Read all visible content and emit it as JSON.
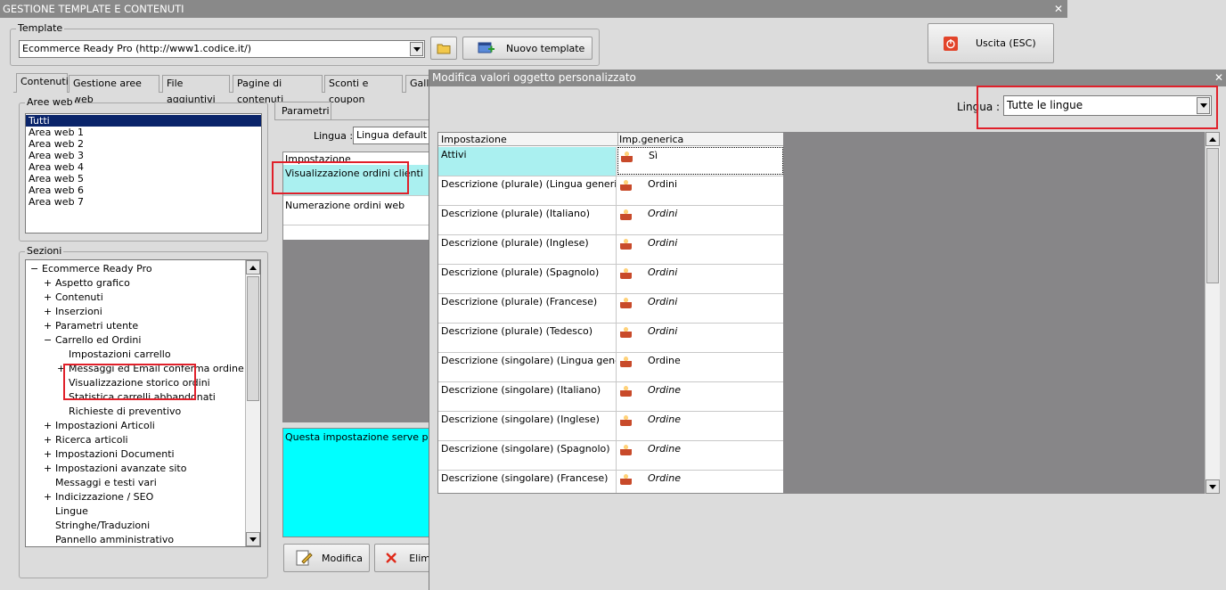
{
  "window": {
    "title": "GESTIONE TEMPLATE E CONTENUTI",
    "close_glyph": "✕"
  },
  "template": {
    "group_label": "Template",
    "selected": "Ecommerce Ready Pro (http://www1.codice.it/)",
    "new_template_label": "Nuovo template"
  },
  "exit_button": {
    "label": "Uscita (ESC)"
  },
  "tabs": [
    {
      "label": "Contenuti",
      "active": true
    },
    {
      "label": "Gestione aree web"
    },
    {
      "label": "File aggiuntivi"
    },
    {
      "label": "Pagine di contenuti"
    },
    {
      "label": "Sconti e coupon"
    },
    {
      "label": "Galle"
    }
  ],
  "aree_web": {
    "label": "Aree web",
    "items": [
      "Tutti",
      "Area web 1",
      "Area web 2",
      "Area web 3",
      "Area web 4",
      "Area web 5",
      "Area web 6",
      "Area web 7"
    ],
    "selected_index": 0
  },
  "sezioni": {
    "label": "Sezioni",
    "tree": [
      {
        "label": "Ecommerce Ready Pro",
        "level": 0,
        "expander": "−"
      },
      {
        "label": "Aspetto grafico",
        "level": 1,
        "expander": "+"
      },
      {
        "label": "Contenuti",
        "level": 1,
        "expander": "+"
      },
      {
        "label": "Inserzioni",
        "level": 1,
        "expander": "+"
      },
      {
        "label": "Parametri utente",
        "level": 1,
        "expander": "+"
      },
      {
        "label": "Carrello ed Ordini",
        "level": 1,
        "expander": "−"
      },
      {
        "label": "Impostazioni carrello",
        "level": 2,
        "expander": ""
      },
      {
        "label": "Messaggi ed Email conferma ordine",
        "level": 2,
        "expander": "+"
      },
      {
        "label": "Visualizzazione storico ordini",
        "level": 2,
        "expander": ""
      },
      {
        "label": "Statistica carrelli abbandonati",
        "level": 2,
        "expander": ""
      },
      {
        "label": "Richieste di preventivo",
        "level": 2,
        "expander": ""
      },
      {
        "label": "Impostazioni Articoli",
        "level": 1,
        "expander": "+"
      },
      {
        "label": "Ricerca articoli",
        "level": 1,
        "expander": "+"
      },
      {
        "label": "Impostazioni Documenti",
        "level": 1,
        "expander": "+"
      },
      {
        "label": "Impostazioni avanzate sito",
        "level": 1,
        "expander": "+"
      },
      {
        "label": "Messaggi e testi vari",
        "level": 1,
        "expander": ""
      },
      {
        "label": "Indicizzazione / SEO",
        "level": 1,
        "expander": "+"
      },
      {
        "label": "Lingue",
        "level": 1,
        "expander": ""
      },
      {
        "label": "Stringhe/Traduzioni",
        "level": 1,
        "expander": ""
      },
      {
        "label": "Pannello amministrativo",
        "level": 1,
        "expander": ""
      }
    ]
  },
  "parametri": {
    "tab_label": "Parametri",
    "lingua_label": "Lingua :",
    "lingua_value": "Lingua default",
    "column_header": "Impostazione",
    "rows": [
      "Visualizzazione ordini clienti",
      "Numerazione ordini web"
    ],
    "description": "Questa impostazione serve per ab",
    "modifica_label": "Modifica",
    "elimina_label": "Elim"
  },
  "dialog": {
    "title": "Modifica valori oggetto personalizzato",
    "lingua_label": "Lingua :",
    "lingua_value": "Tutte le lingue",
    "headers": {
      "name": "Impostazione",
      "value": "Imp.generica"
    },
    "rows": [
      {
        "name": "Attivi",
        "value": "Sì",
        "italic": false
      },
      {
        "name": "Descrizione (plurale) (Lingua generica)",
        "value": "Ordini",
        "italic": false
      },
      {
        "name": "Descrizione (plurale) (Italiano)",
        "value": "Ordini",
        "italic": true
      },
      {
        "name": "Descrizione (plurale) (Inglese)",
        "value": "Ordini",
        "italic": true
      },
      {
        "name": "Descrizione (plurale) (Spagnolo)",
        "value": "Ordini",
        "italic": true
      },
      {
        "name": "Descrizione (plurale) (Francese)",
        "value": "Ordini",
        "italic": true
      },
      {
        "name": "Descrizione (plurale) (Tedesco)",
        "value": "Ordini",
        "italic": true
      },
      {
        "name": "Descrizione (singolare) (Lingua generica)",
        "value": "Ordine",
        "italic": false
      },
      {
        "name": "Descrizione (singolare) (Italiano)",
        "value": "Ordine",
        "italic": true
      },
      {
        "name": "Descrizione (singolare) (Inglese)",
        "value": "Ordine",
        "italic": true
      },
      {
        "name": "Descrizione (singolare) (Spagnolo)",
        "value": "Ordine",
        "italic": true
      },
      {
        "name": "Descrizione (singolare) (Francese)",
        "value": "Ordine",
        "italic": true
      }
    ]
  },
  "colors": {
    "titlebar": "#898989",
    "highlight_cyan": "#aaf0f0",
    "description_bg": "#00ffff",
    "selection": "#0a246a",
    "annotation_red": "#e0202a",
    "dark_panel": "#878688"
  }
}
